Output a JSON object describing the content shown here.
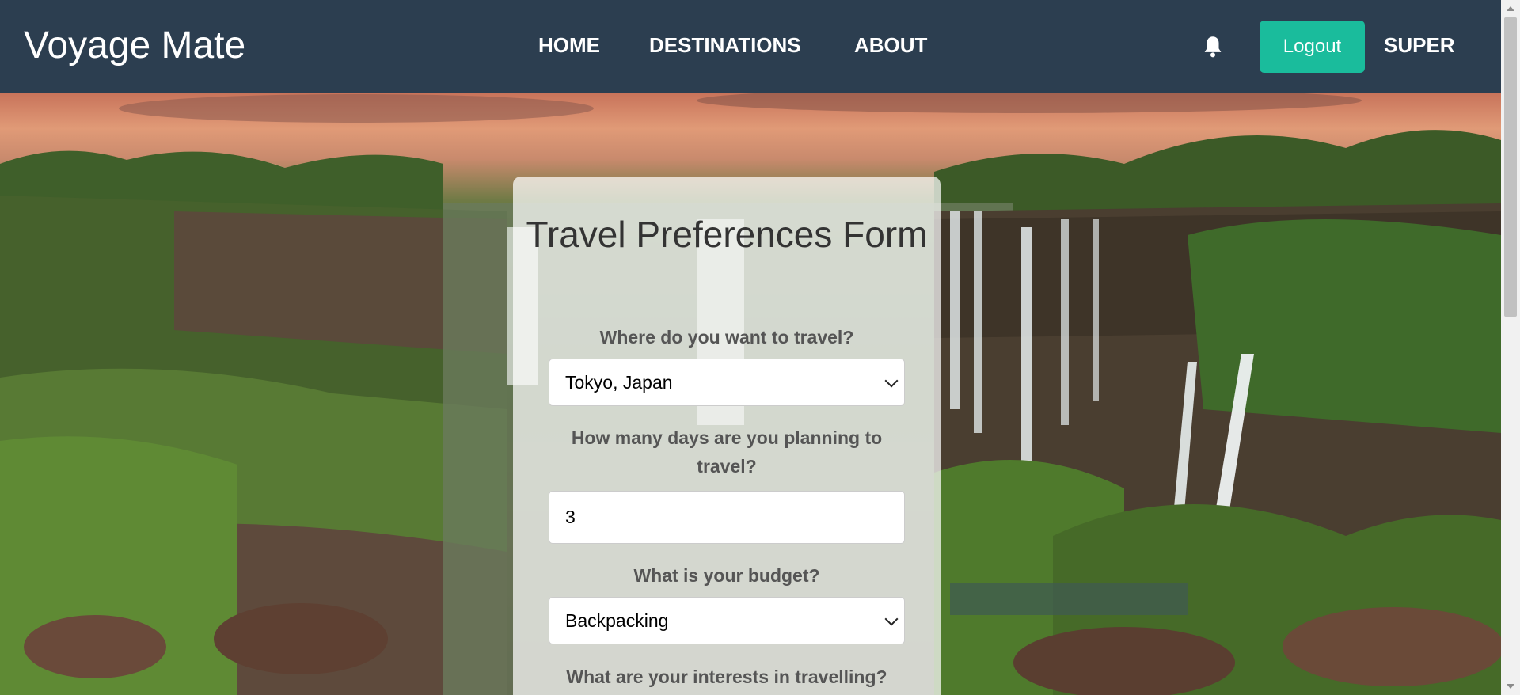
{
  "header": {
    "brand": "Voyage Mate",
    "nav": [
      "HOME",
      "DESTINATIONS",
      "ABOUT"
    ],
    "logout_label": "Logout",
    "user_name": "SUPER",
    "bell_icon": "bell-icon"
  },
  "form": {
    "title": "Travel Preferences Form",
    "destination": {
      "label": "Where do you want to travel?",
      "value": "Tokyo, Japan"
    },
    "days": {
      "label": "How many days are you planning to travel?",
      "value": "3"
    },
    "budget": {
      "label": "What is your budget?",
      "value": "Backpacking"
    },
    "interests": {
      "label": "What are your interests in travelling?"
    }
  },
  "colors": {
    "header_bg": "#2c3e50",
    "accent": "#1abc9c",
    "card_bg": "rgba(255,255,255,0.72)"
  }
}
